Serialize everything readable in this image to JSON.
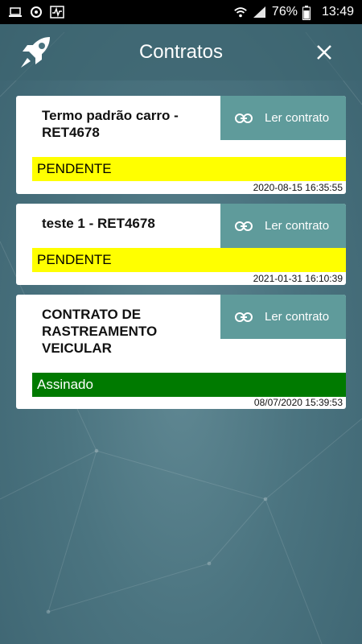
{
  "status_bar": {
    "battery": "76%",
    "time": "13:49"
  },
  "header": {
    "title": "Contratos"
  },
  "contracts": [
    {
      "name": "Termo padrão carro - RET4678",
      "button_label": "Ler contrato",
      "status": "PENDENTE",
      "status_color": "#ffff00",
      "date": "2020-08-15 16:35:55"
    },
    {
      "name": "teste 1 - RET4678",
      "button_label": "Ler contrato",
      "status": "PENDENTE",
      "status_color": "#ffff00",
      "date": "2021-01-31 16:10:39"
    },
    {
      "name": "CONTRATO DE RASTREAMENTO VEICULAR",
      "button_label": "Ler contrato",
      "status": "Assinado",
      "status_color": "#007a00",
      "date": "08/07/2020 15:39:53"
    }
  ],
  "colors": {
    "background": "#4b7480",
    "button": "#5f9b9b",
    "pending": "#ffff00",
    "signed": "#007a00"
  }
}
